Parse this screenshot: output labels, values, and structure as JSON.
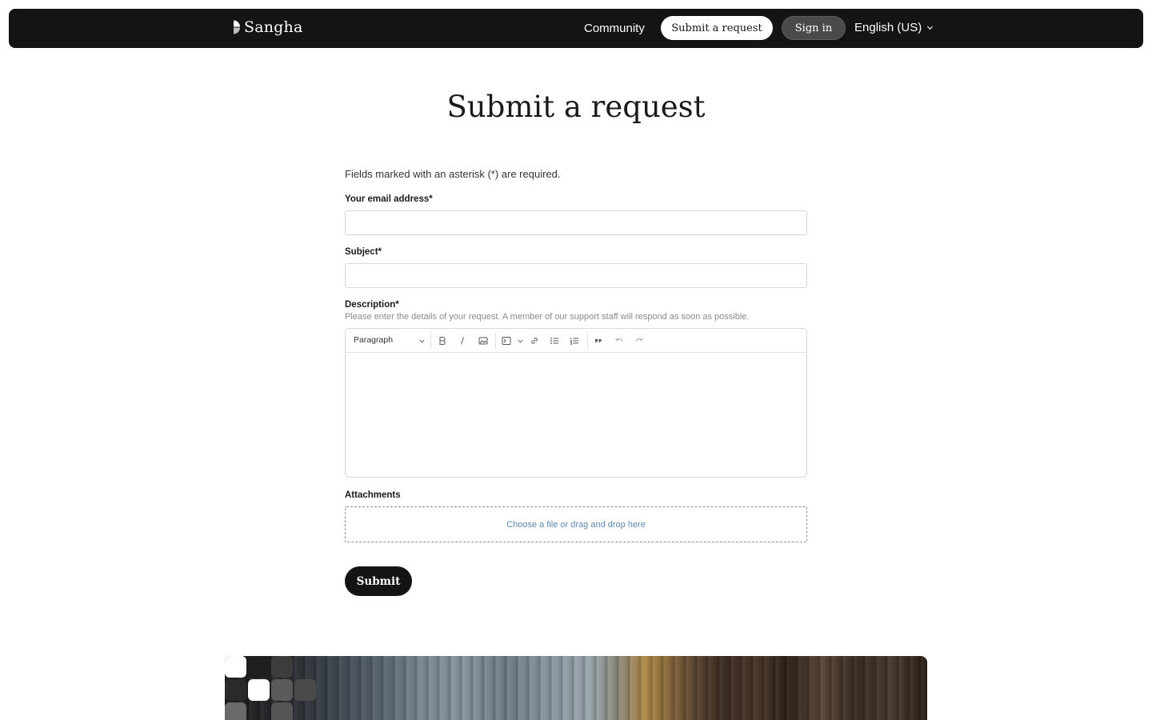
{
  "header": {
    "brand": "Sangha",
    "nav": {
      "community": "Community",
      "submit_request": "Submit a request",
      "sign_in": "Sign in",
      "language": "English (US)"
    }
  },
  "page": {
    "title": "Submit a request"
  },
  "form": {
    "required_note": "Fields marked with an asterisk (*) are required.",
    "email": {
      "label": "Your email address*",
      "value": ""
    },
    "subject": {
      "label": "Subject*",
      "value": ""
    },
    "description": {
      "label": "Description*",
      "hint": "Please enter the details of your request. A member of our support staff will respond as soon as possible.",
      "value": ""
    },
    "editor_toolbar": {
      "block_format": "Paragraph",
      "tools": [
        "bold-icon",
        "italic-icon",
        "image-icon",
        "code-block-icon",
        "link-icon",
        "bulleted-list-icon",
        "numbered-list-icon",
        "quote-icon",
        "undo-icon",
        "redo-icon"
      ]
    },
    "attachments": {
      "label": "Attachments",
      "dropzone_text": "Choose a file or drag and drop here"
    },
    "submit_label": "Submit"
  },
  "colors": {
    "header_bg": "#141414",
    "link_blue": "#5d88b3",
    "button_dark": "#141414"
  }
}
